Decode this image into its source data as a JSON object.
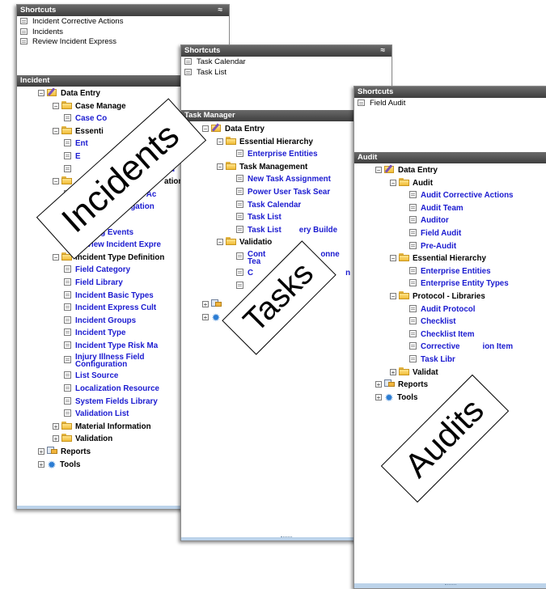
{
  "incidents_panel": {
    "shortcuts_header": "Shortcuts",
    "collapse_glyph": "≈",
    "shortcuts": [
      "Incident Corrective Actions",
      "Incidents",
      "Review Incident Express"
    ],
    "tree_header": "Incident",
    "tree": {
      "data_entry": "Data Entry",
      "case_management": "Case Manage",
      "case_co": "Case Co",
      "essential": "Essenti",
      "ent": "Ent",
      "e2": "E",
      "nu": "Nu",
      "ation": "ation",
      "corrective_ac": "rrective Ac",
      "investigation": "nvestigation",
      "nts": "nts",
      "rating_events": "rating Events",
      "review_express": "Review Incident Expre",
      "incident_type_definitions": "Incident Type Definition",
      "items": [
        "Field Category",
        "Field Library",
        "Incident Basic Types",
        "Incident Express Cult",
        "Incident Groups",
        "Incident Type",
        "Incident Type Risk Ma"
      ],
      "injury_1": "Injury Illness Field",
      "injury_2": "Configuration",
      "items2": [
        "List Source",
        "Localization Resource",
        "System Fields Library",
        "Validation List"
      ],
      "material_information": "Material Information",
      "validation": "Validation",
      "reports": "Reports",
      "tools": "Tools"
    },
    "tag": "Incidents"
  },
  "tasks_panel": {
    "shortcuts_header": "Shortcuts",
    "collapse_glyph": "≈",
    "shortcuts": [
      "Task Calendar",
      "Task List"
    ],
    "tree_header": "Task Manager",
    "tree": {
      "data_entry": "Data Entry",
      "essential_hierarchy": "Essential Hierarchy",
      "enterprise_entities": "Enterprise Entities",
      "task_management": "Task Management",
      "items": [
        "New Task Assignment",
        "Power User Task Sear",
        "Task Calendar",
        "Task List"
      ],
      "task_list_query_a": "Task List",
      "task_list_query_b": "ery Builde",
      "validation": "Validatio",
      "cont_a": "Cont",
      "cont_b": "onne",
      "tea": "Tea",
      "c2": "C",
      "n2": "n"
    },
    "tag": "Tasks"
  },
  "audits_panel": {
    "shortcuts_header": "Shortcuts",
    "shortcuts": [
      "Field Audit"
    ],
    "tree_header": "Audit",
    "tree": {
      "data_entry": "Data Entry",
      "audit": "Audit",
      "audit_items": [
        "Audit Corrective Actions",
        "Audit Team",
        "Auditor",
        "Field Audit",
        "Pre-Audit"
      ],
      "essential_hierarchy": "Essential Hierarchy",
      "essential_items": [
        "Enterprise Entities",
        "Enterprise Entity Types"
      ],
      "protocol_libraries": "Protocol - Libraries",
      "protocol_items": [
        "Audit Protocol",
        "Checklist",
        "Checklist Item"
      ],
      "corrective_a": "Corrective",
      "corrective_b": "ion Item",
      "task_lib": "Task Libr",
      "validation": "Validat",
      "reports": "Reports",
      "tools": "Tools"
    },
    "tag": "Audits"
  },
  "colors": {
    "header_bg": "#4f4f4f",
    "link": "#1a1ad0",
    "folder": "#f0bc37",
    "bottom_bar": "#bcd3ea"
  }
}
